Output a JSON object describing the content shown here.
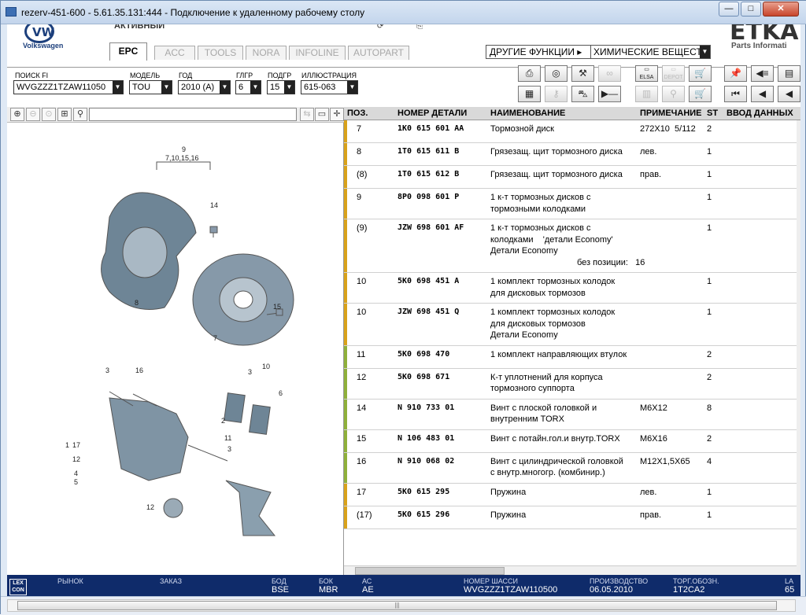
{
  "window": {
    "title": "rezerv-451-600 - 5.61.35.131:444 - Подключение к удаленному рабочему столу",
    "minimize": "—",
    "maximize": "□",
    "close": "✕"
  },
  "header": {
    "brand": "Volkswagen",
    "status": "АКТИВНЫЙ",
    "etka": "ETKA",
    "etka_sub": "Parts Informati",
    "tabs": [
      {
        "label": "EPC",
        "active": true
      },
      {
        "label": "ACC",
        "active": false
      },
      {
        "label": "TOOLS",
        "active": false
      },
      {
        "label": "NORA",
        "active": false
      },
      {
        "label": "INFOLINE",
        "active": false
      },
      {
        "label": "AUTOPART",
        "active": false
      }
    ],
    "other_functions": "ДРУГИЕ ФУНКЦИИ ▸",
    "chem_select": "ХИМИЧЕСКИЕ ВЕЩЕСТВ"
  },
  "filters": {
    "search_fi": {
      "label": "ПОИСК FI",
      "value": "WVGZZZ1TZAW11050"
    },
    "model": {
      "label": "МОДЕЛЬ",
      "value": "TOU"
    },
    "year": {
      "label": "ГОД",
      "value": "2010 (A)"
    },
    "main_group": {
      "label": "ГЛГР",
      "value": "6"
    },
    "sub_group": {
      "label": "ПОДГР",
      "value": "15"
    },
    "illustration": {
      "label": "ИЛЛЮСТРАЦИЯ",
      "value": "615-063"
    }
  },
  "toolbar_icons": [
    "print-icon",
    "cd-icon",
    "car-tools-icon",
    "handshake-icon",
    "elsa-icon",
    "depot-icon",
    "cart-arrow-icon",
    "pin-icon",
    "list-arrow-icon",
    "doc-icon",
    "table-icon",
    "key-icon",
    "car-lift-icon",
    "play-line-icon",
    "doc-stack-icon",
    "bag-icon",
    "cart-icon",
    "first-icon",
    "prev-icon",
    "back-icon"
  ],
  "toolbar_text": {
    "elsa": "ELSA",
    "depot": "DEPOT"
  },
  "grid": {
    "headers": {
      "pos": "ПОЗ.",
      "num": "НОМЕР ДЕТАЛИ",
      "name": "НАИМЕНОВАНИЕ",
      "note": "ПРИМЕЧАНИЕ",
      "st": "ST",
      "input": "ВВОД ДАННЫХ"
    },
    "rows": [
      {
        "pos": "7",
        "num": "1K0 615 601 AA",
        "name": [
          "Тормозной диск"
        ],
        "note": "272X10  5/112",
        "st": "2",
        "mark": "#d9a21b"
      },
      {
        "pos": "8",
        "num": "1T0 615 611 B",
        "name": [
          "Грязезащ. щит тормозного диска"
        ],
        "note": "лев.",
        "st": "1",
        "mark": "#d9a21b"
      },
      {
        "pos": "(8)",
        "num": "1T0 615 612 B",
        "name": [
          "Грязезащ. щит тормозного диска"
        ],
        "note": "прав.",
        "st": "1",
        "mark": "#d9a21b"
      },
      {
        "pos": "9",
        "num": "8P0 098 601 P",
        "name": [
          "1 к-т тормозных дисков с",
          "тормозными колодками"
        ],
        "note": "",
        "st": "1",
        "mark": "#d9a21b"
      },
      {
        "pos": "(9)",
        "num": "JZW 698 601 AF",
        "name": [
          "1 к-т тормозных дисков с",
          "колодками    'детали Economy'",
          "Детали Economy",
          "без позиции:   16"
        ],
        "note": "",
        "st": "1",
        "mark": "#d9a21b"
      },
      {
        "pos": "10",
        "num": "5K0 698 451 A",
        "name": [
          "1 комплект тормозных колодок",
          "для дисковых тормозов"
        ],
        "note": "",
        "st": "1",
        "mark": "#d9a21b"
      },
      {
        "pos": "10",
        "num": "JZW 698 451 Q",
        "name": [
          "1 комплект тормозных колодок",
          "для дисковых тормозов",
          "Детали Economy"
        ],
        "note": "",
        "st": "1",
        "mark": "#d9a21b"
      },
      {
        "pos": "11",
        "num": "5K0 698 470",
        "name": [
          "1 комплект направляющих втулок"
        ],
        "note": "",
        "st": "2",
        "mark": "#8fb03a"
      },
      {
        "pos": "12",
        "num": "5K0 698 671",
        "name": [
          "К-т уплотнений для корпуса",
          "тормозного суппорта"
        ],
        "note": "",
        "st": "2",
        "mark": "#8fb03a"
      },
      {
        "pos": "14",
        "num": "N    910 733 01",
        "name": [
          "Винт с плоской головкой и",
          "внутренним TORX"
        ],
        "note": "M6X12",
        "st": "8",
        "mark": "#8fb03a"
      },
      {
        "pos": "15",
        "num": "N    106 483 01",
        "name": [
          "Винт с потайн.гол.и внутр.TORX"
        ],
        "note": "M6X16",
        "st": "2",
        "mark": "#8fb03a"
      },
      {
        "pos": "16",
        "num": "N    910 068 02",
        "name": [
          "Винт с цилиндрической головкой",
          "с внутр.многогр. (комбинир.)"
        ],
        "note": "M12X1,5X65",
        "st": "4",
        "mark": "#8fb03a"
      },
      {
        "pos": "17",
        "num": "5K0 615 295",
        "name": [
          "Пружина"
        ],
        "note": "лев.",
        "st": "1",
        "mark": "#d9a21b"
      },
      {
        "pos": "(17)",
        "num": "5K0 615 296",
        "name": [
          "Пружина"
        ],
        "note": "прав.",
        "st": "1",
        "mark": "#d9a21b"
      }
    ]
  },
  "diagram_labels": [
    "9",
    "7,10,15,16",
    "14",
    "8",
    "15",
    "7",
    "3",
    "16",
    "10",
    "3",
    "6",
    "1",
    "2",
    "17",
    "12",
    "4",
    "5",
    "11",
    "12",
    "3"
  ],
  "statusbar": {
    "lexcon": "LEX CON",
    "fields": [
      {
        "label": "РЫНОК",
        "value": ""
      },
      {
        "label": "ЗАКАЗ",
        "value": ""
      },
      {
        "label": "БОД",
        "value": "BSE"
      },
      {
        "label": "БОК",
        "value": "MBR"
      },
      {
        "label": "АС",
        "value": "AE"
      },
      {
        "label": "НОМЕР ШАССИ",
        "value": "WVGZZZ1TZAW110500"
      },
      {
        "label": "ПРОИЗВОДСТВО",
        "value": "06.05.2010"
      },
      {
        "label": "ТОРГ.ОБОЗН.",
        "value": "1T2CA2"
      },
      {
        "label": "LA",
        "value": "65"
      }
    ]
  },
  "colors": {
    "accent_yellow": "#d9a21b",
    "accent_green": "#8fb03a",
    "statusbar": "#0f2b6a"
  }
}
